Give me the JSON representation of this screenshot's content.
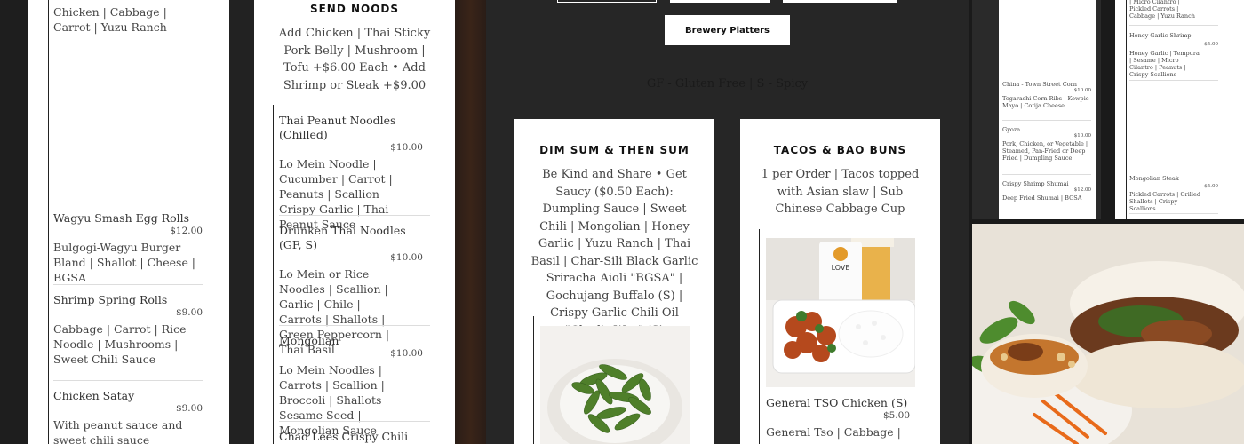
{
  "col1": {
    "top_desc": "Chicken | Cabbage | Carrot | Yuzu Ranch",
    "items": [
      {
        "name": "Wagyu Smash Egg Rolls",
        "price": "$12.00",
        "desc": "Bulgogi-Wagyu Burger Bland | Shallot | Cheese | BGSA"
      },
      {
        "name": "Shrimp Spring Rolls",
        "price": "$9.00",
        "desc": "Cabbage | Carrot | Rice Noodle | Mushrooms | Sweet Chili Sauce"
      },
      {
        "name": "Chicken Satay",
        "price": "$9.00",
        "desc": "With peanut sauce and sweet chili sauce"
      }
    ]
  },
  "col2": {
    "heading": "SEND NOODS",
    "intro": "Add Chicken | Thai Sticky Pork Belly | Mushroom | Tofu +$6.00 Each • Add Shrimp or Steak +$9.00",
    "items": [
      {
        "name": "Thai Peanut Noodles (Chilled)",
        "price": "$10.00",
        "desc": "Lo Mein Noodle | Cucumber | Carrot | Peanuts | Scallion Crispy Garlic | Thai Peanut Sauce"
      },
      {
        "name": "Drunken Thai Noodles (GF, S)",
        "price": "$10.00",
        "desc": "Lo Mein or Rice Noodles | Scallion | Garlic | Chile | Carrots | Shallots | Green Peppercorn | Thai Basil"
      },
      {
        "name": "Mongolian",
        "price": "$10.00",
        "desc": "Lo Mein Noodles | Carrots | Scallion | Broccoli | Shallots | Sesame Seed | Mongolian Sauce"
      },
      {
        "name": "Chad Lees Crispy Chili Garlic (S)"
      }
    ]
  },
  "main": {
    "tabs": [
      "",
      "",
      ""
    ],
    "platters_button": "Brewery Platters",
    "legend": "GF - Gluten Free | S - Spicy",
    "card_left": {
      "heading": "DIM SUM & THEN SUM",
      "text": "Be Kind and Share • Get Saucy ($0.50 Each): Dumpling Sauce | Sweet Chili | Mongolian | Honey Garlic | Yuzu Ranch | Thai Basil | Char-Sili Black Garlic Sriracha Aioli \"BGSA\" | Gochujang Buffalo (S) | Crispy Garlic Chili Oil \"Chad's Way\" (S)"
    },
    "card_right": {
      "heading": "TACOS & BAO BUNS",
      "text": "1 per Order | Tacos topped with Asian slaw | Sub Chinese Cabbage Cup",
      "item_name": "General TSO Chicken (S)",
      "item_price": "$5.00",
      "item_desc": "General Tso | Cabbage |",
      "cup_brand": "LOVE"
    }
  },
  "thumb1": {
    "top": "| Cabbage | Carrot | Yuzu",
    "items": [
      {
        "name": "China - Town Street Corn",
        "price": "$10.00",
        "desc": "Togarashi Corn Ribs | Kewpie Mayo | Cotija Cheese"
      },
      {
        "name": "Gyoza",
        "price": "$10.00",
        "desc": "Pork, Chicken, or Vegetable | Steamed, Pan-Fried or Deep Fried | Dumpling Sauce"
      },
      {
        "name": "Crispy Shrimp Shumai",
        "price": "$12.00",
        "desc": "Deep Fried Shumai | BGSA"
      }
    ]
  },
  "thumb2": {
    "top": "| Micro Cilantro | Pickled Carrots | Cabbage | Yuzu Ranch",
    "items": [
      {
        "name": "Honey Garlic Shrimp",
        "price": "$5.00",
        "desc": "Honey Garlic | Tempura | Sesame | Micro Cilantro | Peanuts | Crispy Scallions"
      },
      {
        "name": "Mongolian Steak",
        "price": "$5.00",
        "desc": "Pickled Carrots | Grilled Shallots | Crispy Scallions"
      }
    ]
  }
}
